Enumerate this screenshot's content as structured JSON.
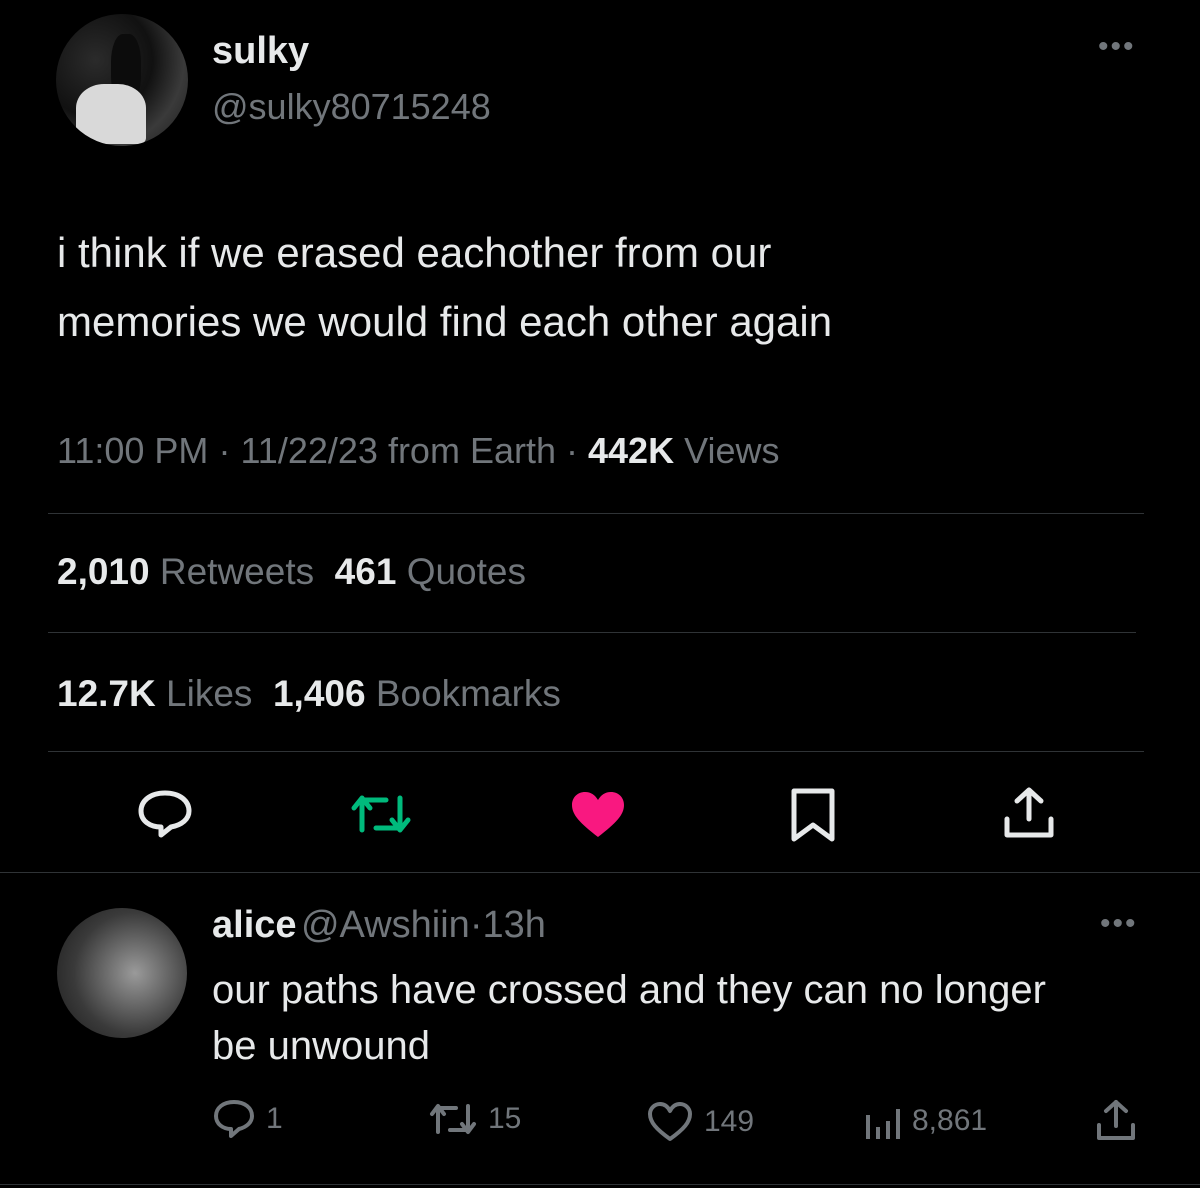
{
  "tweet": {
    "display_name": "sulky",
    "handle": "@sulky80715248",
    "more_icon": "ellipsis-icon",
    "text_line1": "i think if we erased eachother from our",
    "text_line2": "memories we would find each other again",
    "time": "11:00 PM",
    "date": "11/22/23",
    "source": "from Earth",
    "sep": "·",
    "views_count": "442K",
    "views_label": "Views",
    "retweets_count": "2,010",
    "retweets_label": "Retweets",
    "quotes_count": "461",
    "quotes_label": "Quotes",
    "likes_count": "12.7K",
    "likes_label": "Likes",
    "bookmarks_count": "1,406",
    "bookmarks_label": "Bookmarks",
    "actions": {
      "reply_icon": "speech-bubble-icon",
      "retweet_icon": "retweet-icon",
      "like_icon": "heart-filled-icon",
      "bookmark_icon": "bookmark-icon",
      "share_icon": "share-icon"
    }
  },
  "reply": {
    "display_name": "alice",
    "handle": "@Awshiin",
    "sep": "·",
    "time_ago": "13h",
    "text_line1": "our paths have crossed and they can no longer",
    "text_line2": "be unwound",
    "replies": "1",
    "retweets": "15",
    "likes": "149",
    "views": "8,861"
  },
  "colors": {
    "background": "#000000",
    "text": "#e7e9ea",
    "muted": "#71767b",
    "retweet_active": "#00ba7c",
    "like_active": "#f91880",
    "divider": "#2f3336"
  }
}
